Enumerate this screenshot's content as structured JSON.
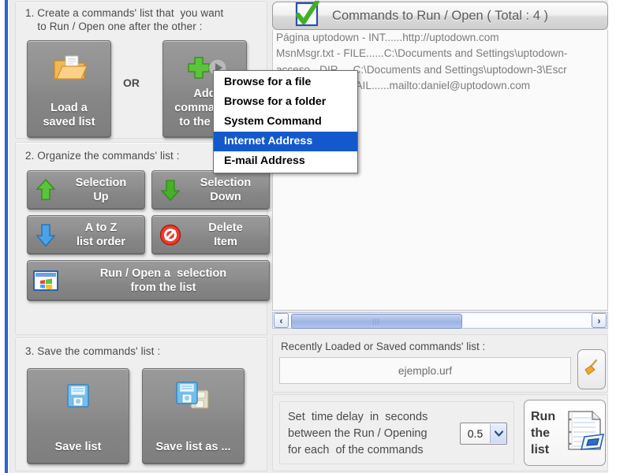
{
  "window": {
    "border_color": "#1b53c4"
  },
  "steps": {
    "step1_title": "1. Create a commands' list that  you want\n    to Run / Open one after the other :",
    "step2_title": "2. Organize the commands' list :",
    "step3_title": "3. Save the commands' list :"
  },
  "buttons": {
    "load_saved_list": "Load a\nsaved list",
    "or": "OR",
    "add_commands": "Add\ncommands\nto the list",
    "selection_up": "Selection\nUp",
    "selection_down": "Selection\nDown",
    "a_to_z": "A to Z\nlist order",
    "delete_item": "Delete\nItem",
    "run_open_selection": "Run / Open a  selection\nfrom the list",
    "save_list": "Save list",
    "save_list_as": "Save list as ..."
  },
  "list_panel": {
    "header": "Commands to Run / Open ( Total : 4 )",
    "header_icon": "green-check-box-icon",
    "items": [
      "Página uptodown - INT......http://uptodown.com",
      "MsnMsgr.txt - FILE......C:\\Documents and Settings\\uptodown-",
      "acceso - DIR ....C:\\Documents and Settings\\uptodown-3\\Escr",
      "daniel.garcia - MAIL......mailto:daniel@uptodown.com"
    ],
    "scrollbar": {
      "left_arrow": "‹",
      "right_arrow": "›"
    }
  },
  "context_menu": {
    "items": [
      {
        "label": "Browse for a file",
        "selected": false
      },
      {
        "label": "Browse for a folder",
        "selected": false
      },
      {
        "label": "System Command",
        "selected": false
      },
      {
        "label": "Internet Address",
        "selected": true
      },
      {
        "label": "E-mail Address",
        "selected": false
      }
    ],
    "highlight_color": "#1459cc"
  },
  "recent": {
    "label": "Recently Loaded or Saved commands' list :",
    "value": "ejemplo.urf",
    "clear_icon": "broom-icon"
  },
  "delay": {
    "text": "Set  time delay  in  seconds\nbetween the Run / Opening\nfor each  of the commands",
    "value": "0.5",
    "arrow": "▼"
  },
  "run_list": {
    "label": "Run\nthe\nlist",
    "icon": "run-list-document-icon"
  }
}
